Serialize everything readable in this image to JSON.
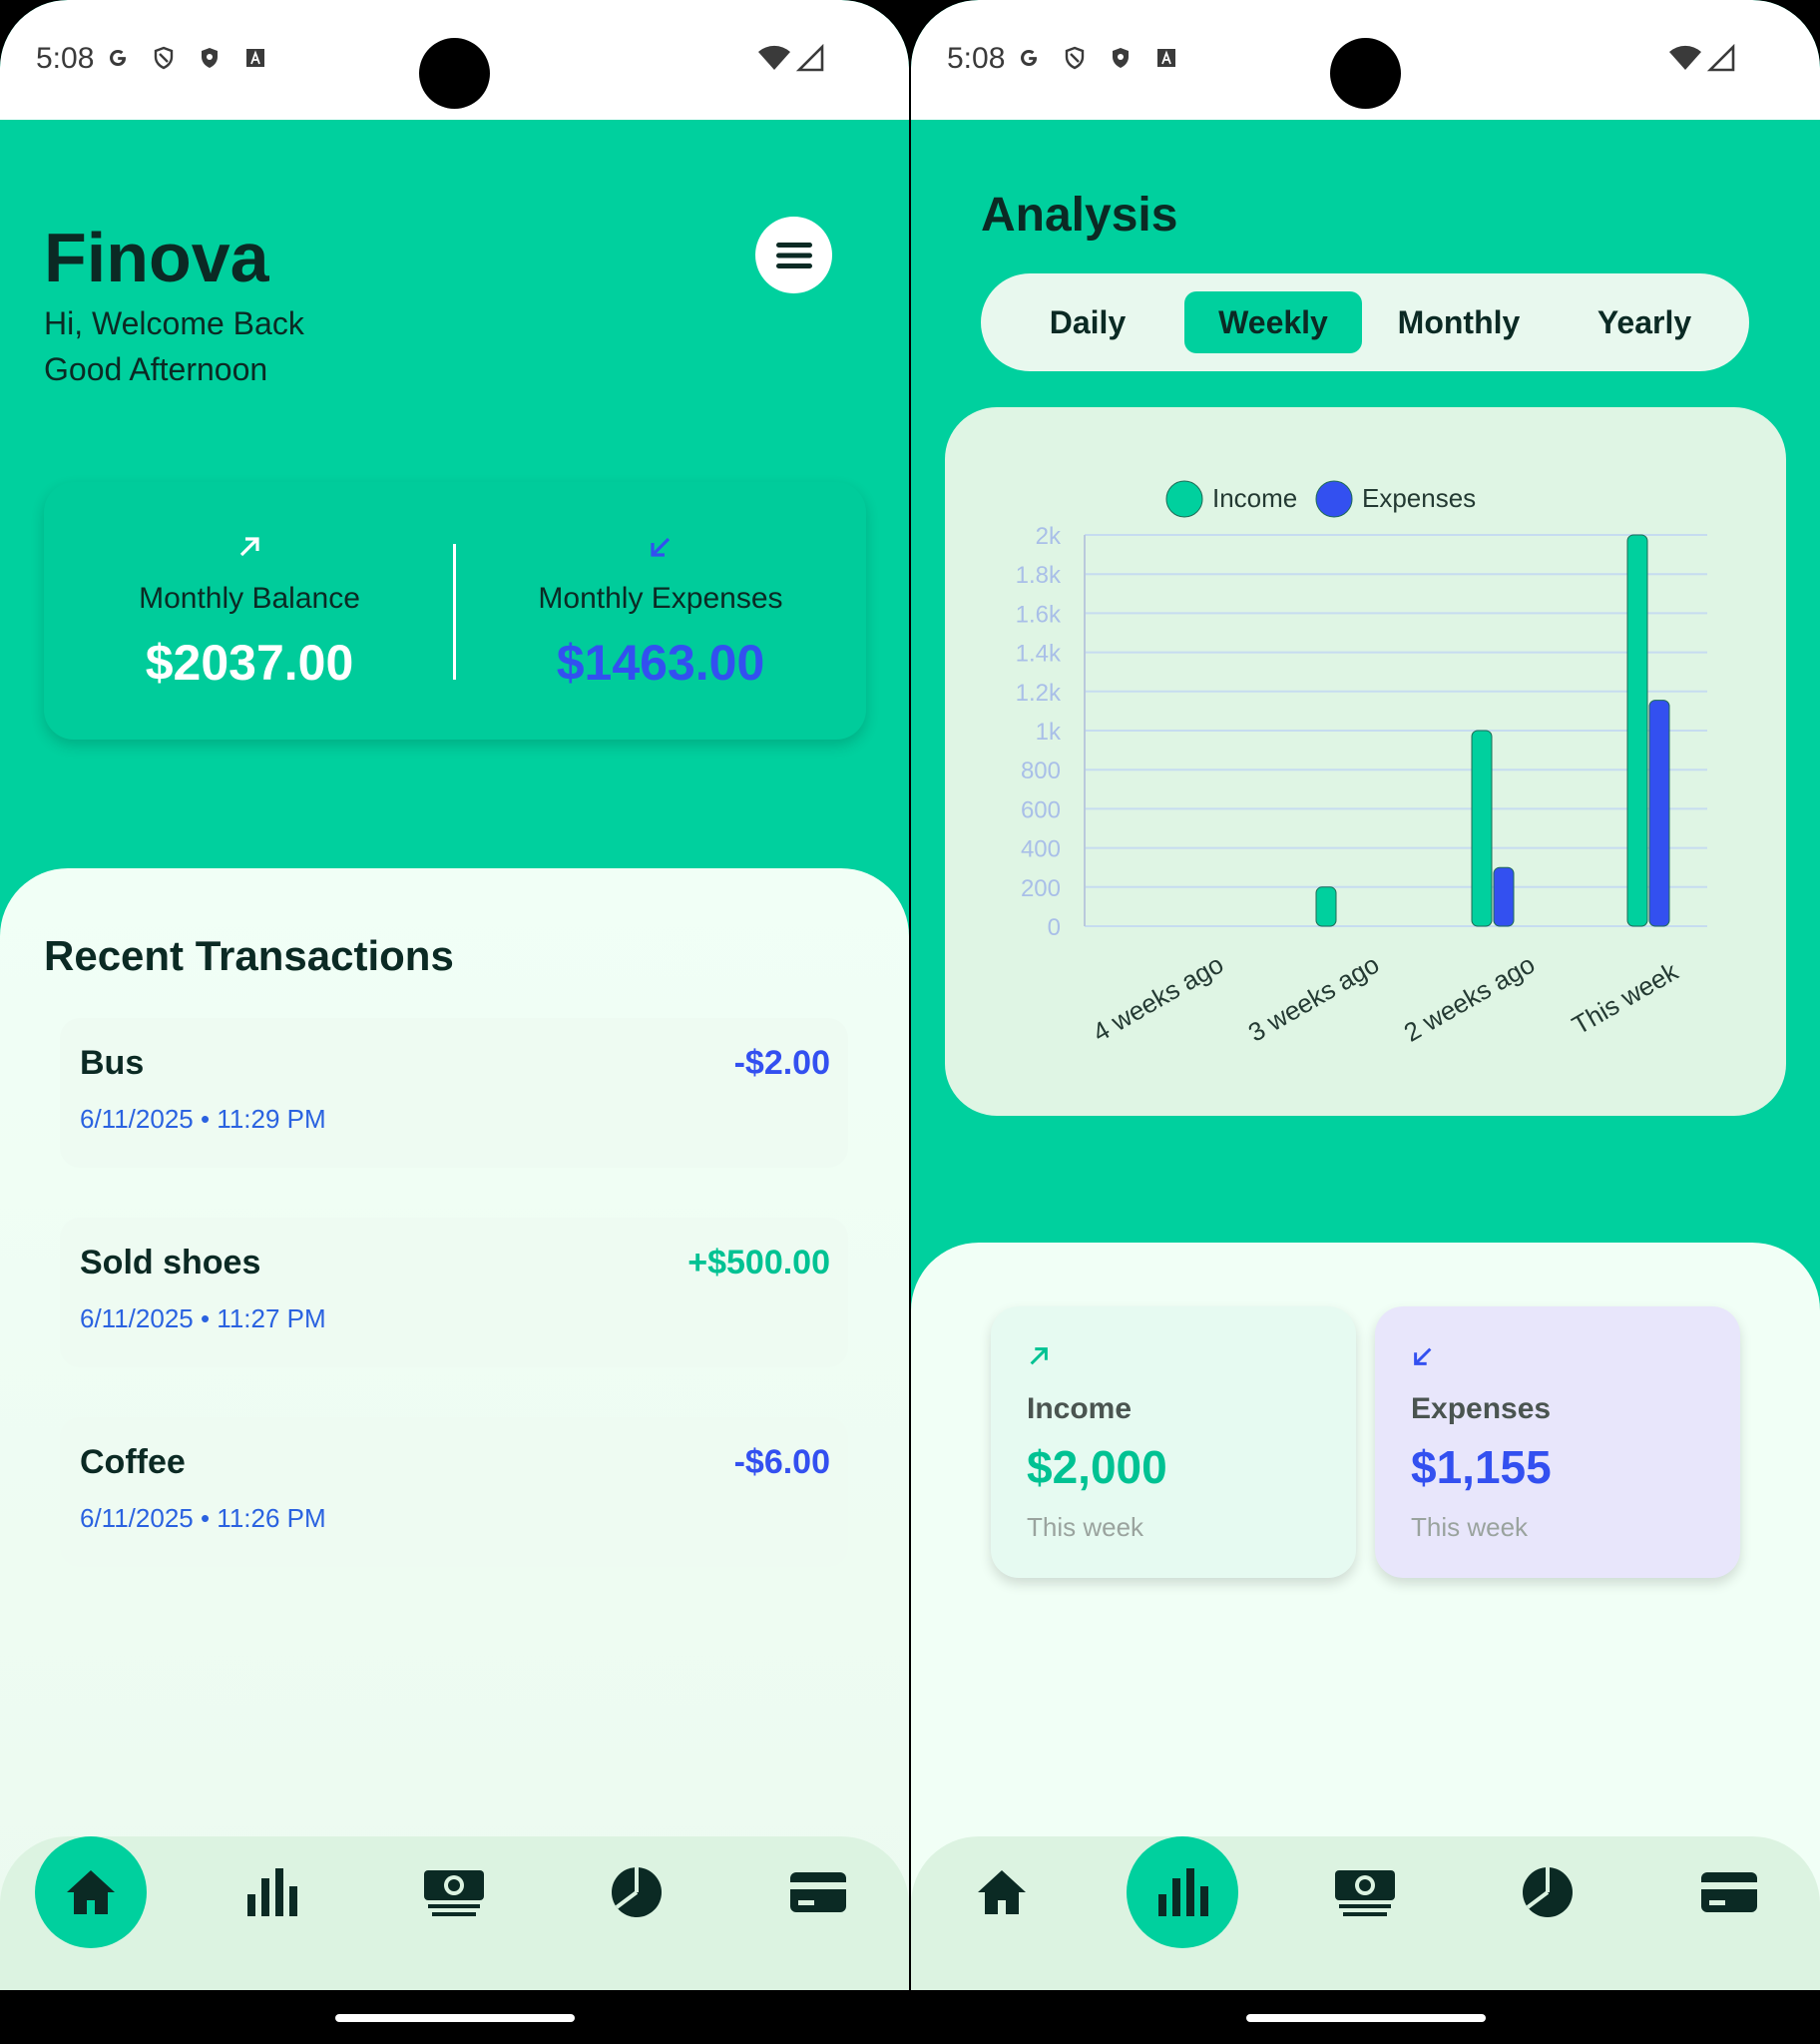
{
  "status": {
    "time": "5:08"
  },
  "home": {
    "app_name": "Finova",
    "greeting": "Hi, Welcome Back",
    "greeting_sub": "Good Afternoon",
    "balance_label": "Monthly Balance",
    "balance_value": "$2037.00",
    "expenses_label": "Monthly Expenses",
    "expenses_value": "$1463.00",
    "recent_title": "Recent Transactions",
    "transactions": [
      {
        "name": "Bus",
        "amount": "-$2.00",
        "date": "6/11/2025 • 11:29 PM",
        "type": "expense"
      },
      {
        "name": "Sold shoes",
        "amount": "+$500.00",
        "date": "6/11/2025 • 11:27 PM",
        "type": "income"
      },
      {
        "name": "Coffee",
        "amount": "-$6.00",
        "date": "6/11/2025 • 11:26 PM",
        "type": "expense"
      }
    ]
  },
  "analysis": {
    "title": "Analysis",
    "tabs": [
      "Daily",
      "Weekly",
      "Monthly",
      "Yearly"
    ],
    "active_tab": "Weekly",
    "income_label": "Income",
    "income_value": "$2,000",
    "income_sub": "This week",
    "expenses_label": "Expenses",
    "expenses_value": "$1,155",
    "expenses_sub": "This week"
  },
  "nav": {
    "items": [
      "home-icon",
      "analysis-icon",
      "transactions-icon",
      "categories-icon",
      "card-icon"
    ],
    "left_active": "home-icon",
    "right_active": "analysis-icon"
  },
  "colors": {
    "primary": "#00D09E",
    "income": "#00D09E",
    "expense": "#3350F0",
    "dark_text": "#0b2a24",
    "date_text": "#2a62e0"
  },
  "chart_data": {
    "type": "bar",
    "categories": [
      "4 weeks ago",
      "3 weeks ago",
      "2 weeks ago",
      "This week"
    ],
    "series": [
      {
        "name": "Income",
        "values": [
          0,
          200,
          1000,
          2000
        ],
        "color": "#00D09E"
      },
      {
        "name": "Expenses",
        "values": [
          0,
          0,
          300,
          1155
        ],
        "color": "#3350F0"
      }
    ],
    "yticks": [
      "0",
      "200",
      "400",
      "600",
      "800",
      "1k",
      "1.2k",
      "1.4k",
      "1.6k",
      "1.8k",
      "2k"
    ],
    "ylim": [
      0,
      2000
    ],
    "grid": true,
    "legend": "top-center"
  }
}
